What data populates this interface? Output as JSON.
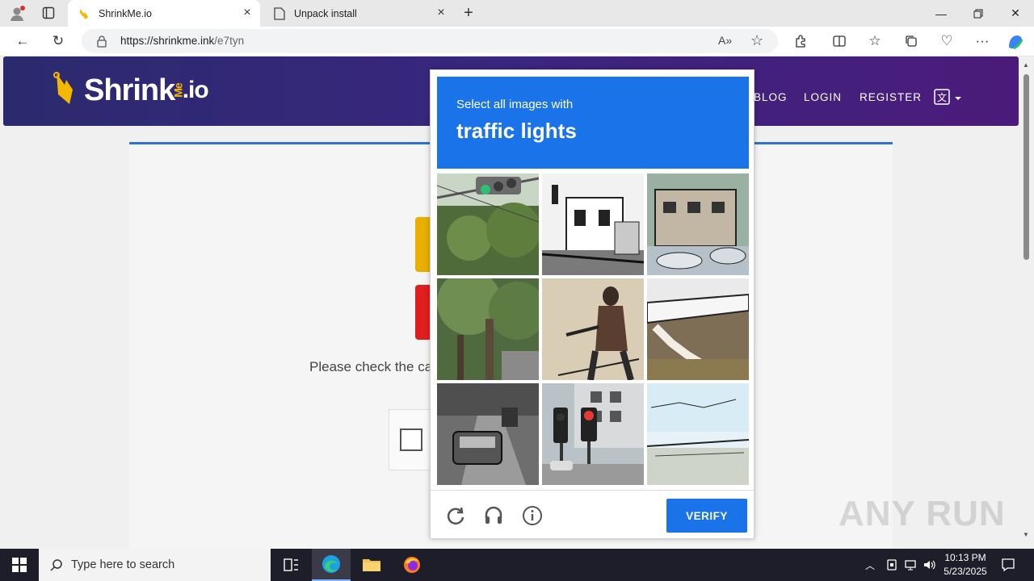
{
  "browser": {
    "tabs": [
      {
        "label": "ShrinkMe.io",
        "active": true
      },
      {
        "label": "Unpack install",
        "active": false
      }
    ],
    "url": {
      "host": "https://shrinkme.ink",
      "path": "/e7tyn"
    }
  },
  "site": {
    "logo_text": "Shrink",
    "logo_sub": "Me",
    "logo_tld": ".io",
    "menu": [
      "BLOG",
      "LOGIN",
      "REGISTER"
    ],
    "note": "Please check the ca"
  },
  "captcha": {
    "instruction": "Select all images with",
    "target": "traffic lights",
    "verify_label": "VERIFY",
    "tiles": [
      "traffic-light-trees",
      "street-buildings",
      "building-cars",
      "tree-street",
      "person-street",
      "bridge-stairs",
      "street-cars",
      "crosswalk-traffic-light",
      "sky-landscape"
    ]
  },
  "watermark": "ANY RUN",
  "taskbar": {
    "search_placeholder": "Type here to search",
    "time": "10:13 PM",
    "date": "5/23/2025"
  }
}
